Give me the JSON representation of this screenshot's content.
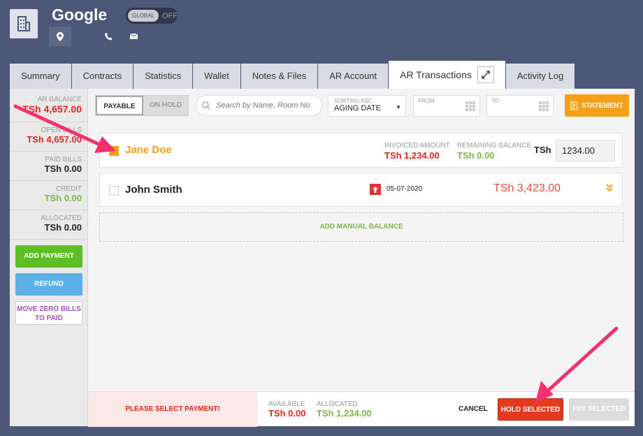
{
  "header": {
    "company_name": "Google",
    "toggle_label": "GLOBAL",
    "toggle_state": "OFF"
  },
  "tabs": [
    {
      "label": "Summary"
    },
    {
      "label": "Contracts"
    },
    {
      "label": "Statistics"
    },
    {
      "label": "Wallet"
    },
    {
      "label": "Notes & Files"
    },
    {
      "label": "AR Account"
    },
    {
      "label": "AR Transactions",
      "active": true
    },
    {
      "label": "Activity Log"
    }
  ],
  "sidebar": {
    "stats": [
      {
        "label": "AR BALANCE",
        "value": "TSh 4,657.00",
        "color": "red"
      },
      {
        "label": "OPEN BILLS",
        "value": "TSh 4,657.00",
        "color": "red"
      },
      {
        "label": "PAID BILLS",
        "value": "TSh 0.00",
        "color": "dark"
      },
      {
        "label": "CREDIT",
        "value": "TSh 0.00",
        "color": "green"
      },
      {
        "label": "ALLOCATED",
        "value": "TSh 0.00",
        "color": "dark"
      }
    ],
    "add_payment": "ADD PAYMENT",
    "refund": "REFUND",
    "move_zero": "MOVE ZERO BILLS TO PAID"
  },
  "toolbar": {
    "payable": "PAYABLE",
    "on_hold": "ON HOLD",
    "search_placeholder": "Search by Name, Room No",
    "sort_label": "SORTING ASC",
    "sort_value": "AGING DATE",
    "from_label": "FROM",
    "to_label": "TO",
    "statement": "STATEMENT"
  },
  "rows": [
    {
      "name": "Jane Doe",
      "checked": true,
      "invoiced_label": "INVOICED AMOUNT",
      "invoiced_value": "TSh 1,234.00",
      "remaining_label": "REMAINING BALANCE",
      "remaining_value": "TSh 0.00",
      "currency": "TSh",
      "amount_input": "1234.00"
    },
    {
      "name": "John Smith",
      "checked": false,
      "date": "05-07-2020",
      "amount": "TSh 3,423.00"
    }
  ],
  "add_manual_balance": "ADD MANUAL BALANCE",
  "footer": {
    "warning": "PLEASE SELECT PAYMENT!",
    "available_label": "AVAILABLE",
    "available_value": "TSh 0.00",
    "allocated_label": "ALLOCATED",
    "allocated_value": "TSh 1,234.00",
    "cancel": "CANCEL",
    "hold_selected": "HOLD SELECTED",
    "pay_selected": "PAY SELECTED"
  },
  "colors": {
    "background": "#4d5878",
    "accent_orange": "#f6a01a",
    "danger_red": "#e53a1f",
    "success_green": "#7ab648",
    "arrow_pink": "#f5306e"
  }
}
